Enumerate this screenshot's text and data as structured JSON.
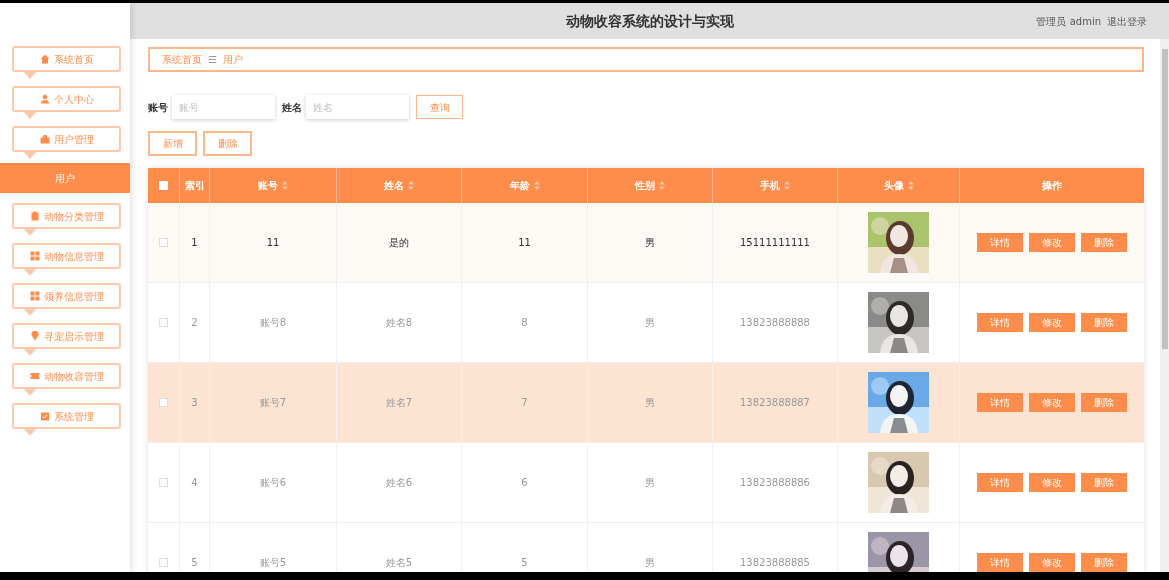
{
  "header": {
    "title": "动物收容系统的设计与实现",
    "user": "管理员 admin",
    "logout": "退出登录"
  },
  "sidebar": {
    "items": [
      {
        "label": "系统首页",
        "selected": false
      },
      {
        "label": "个人中心",
        "selected": false
      },
      {
        "label": "用户管理",
        "selected": false,
        "children": [
          {
            "label": "用户",
            "selected": true
          }
        ]
      },
      {
        "label": "动物分类管理",
        "selected": false
      },
      {
        "label": "动物信息管理",
        "selected": false
      },
      {
        "label": "领养信息管理",
        "selected": false
      },
      {
        "label": "寻宠启示管理",
        "selected": false
      },
      {
        "label": "动物收容管理",
        "selected": false
      },
      {
        "label": "系统管理",
        "selected": false
      }
    ]
  },
  "breadcrumb": [
    "系统首页",
    "用户"
  ],
  "breadcrumb_separator": "☰",
  "search": {
    "fields": [
      {
        "label": "账号",
        "placeholder": "账号"
      },
      {
        "label": "姓名",
        "placeholder": "姓名"
      }
    ],
    "button": "查询"
  },
  "actions": [
    "新增",
    "删除"
  ],
  "table": {
    "select_all_checked": false,
    "columns": [
      {
        "label": "索引",
        "sortable": false
      },
      {
        "label": "账号",
        "sortable": true
      },
      {
        "label": "姓名",
        "sortable": true
      },
      {
        "label": "年龄",
        "sortable": true
      },
      {
        "label": "性别",
        "sortable": true
      },
      {
        "label": "手机",
        "sortable": true
      },
      {
        "label": "头像",
        "sortable": true
      },
      {
        "label": "操作",
        "sortable": false
      }
    ],
    "rows": [
      {
        "index": "1",
        "account": "11",
        "name": "是的",
        "age": "11",
        "gender": "男",
        "phone": "15111111111",
        "checked": false,
        "hovered": true,
        "selected": false,
        "buttons": [
          "详情",
          "修改",
          "删除"
        ]
      },
      {
        "index": "2",
        "account": "账号8",
        "name": "姓名8",
        "age": "8",
        "gender": "男",
        "phone": "13823888888",
        "checked": false,
        "hovered": false,
        "selected": false,
        "buttons": [
          "详情",
          "修改",
          "删除"
        ]
      },
      {
        "index": "3",
        "account": "账号7",
        "name": "姓名7",
        "age": "7",
        "gender": "男",
        "phone": "13823888887",
        "checked": false,
        "hovered": false,
        "selected": true,
        "buttons": [
          "详情",
          "修改",
          "删除"
        ]
      },
      {
        "index": "4",
        "account": "账号6",
        "name": "姓名6",
        "age": "6",
        "gender": "男",
        "phone": "13823888886",
        "checked": false,
        "hovered": false,
        "selected": false,
        "buttons": [
          "详情",
          "修改",
          "删除"
        ]
      },
      {
        "index": "5",
        "account": "账号5",
        "name": "姓名5",
        "age": "5",
        "gender": "男",
        "phone": "13823888885",
        "checked": false,
        "hovered": false,
        "selected": false,
        "buttons": [
          "详情",
          "修改",
          "删除"
        ]
      }
    ]
  }
}
